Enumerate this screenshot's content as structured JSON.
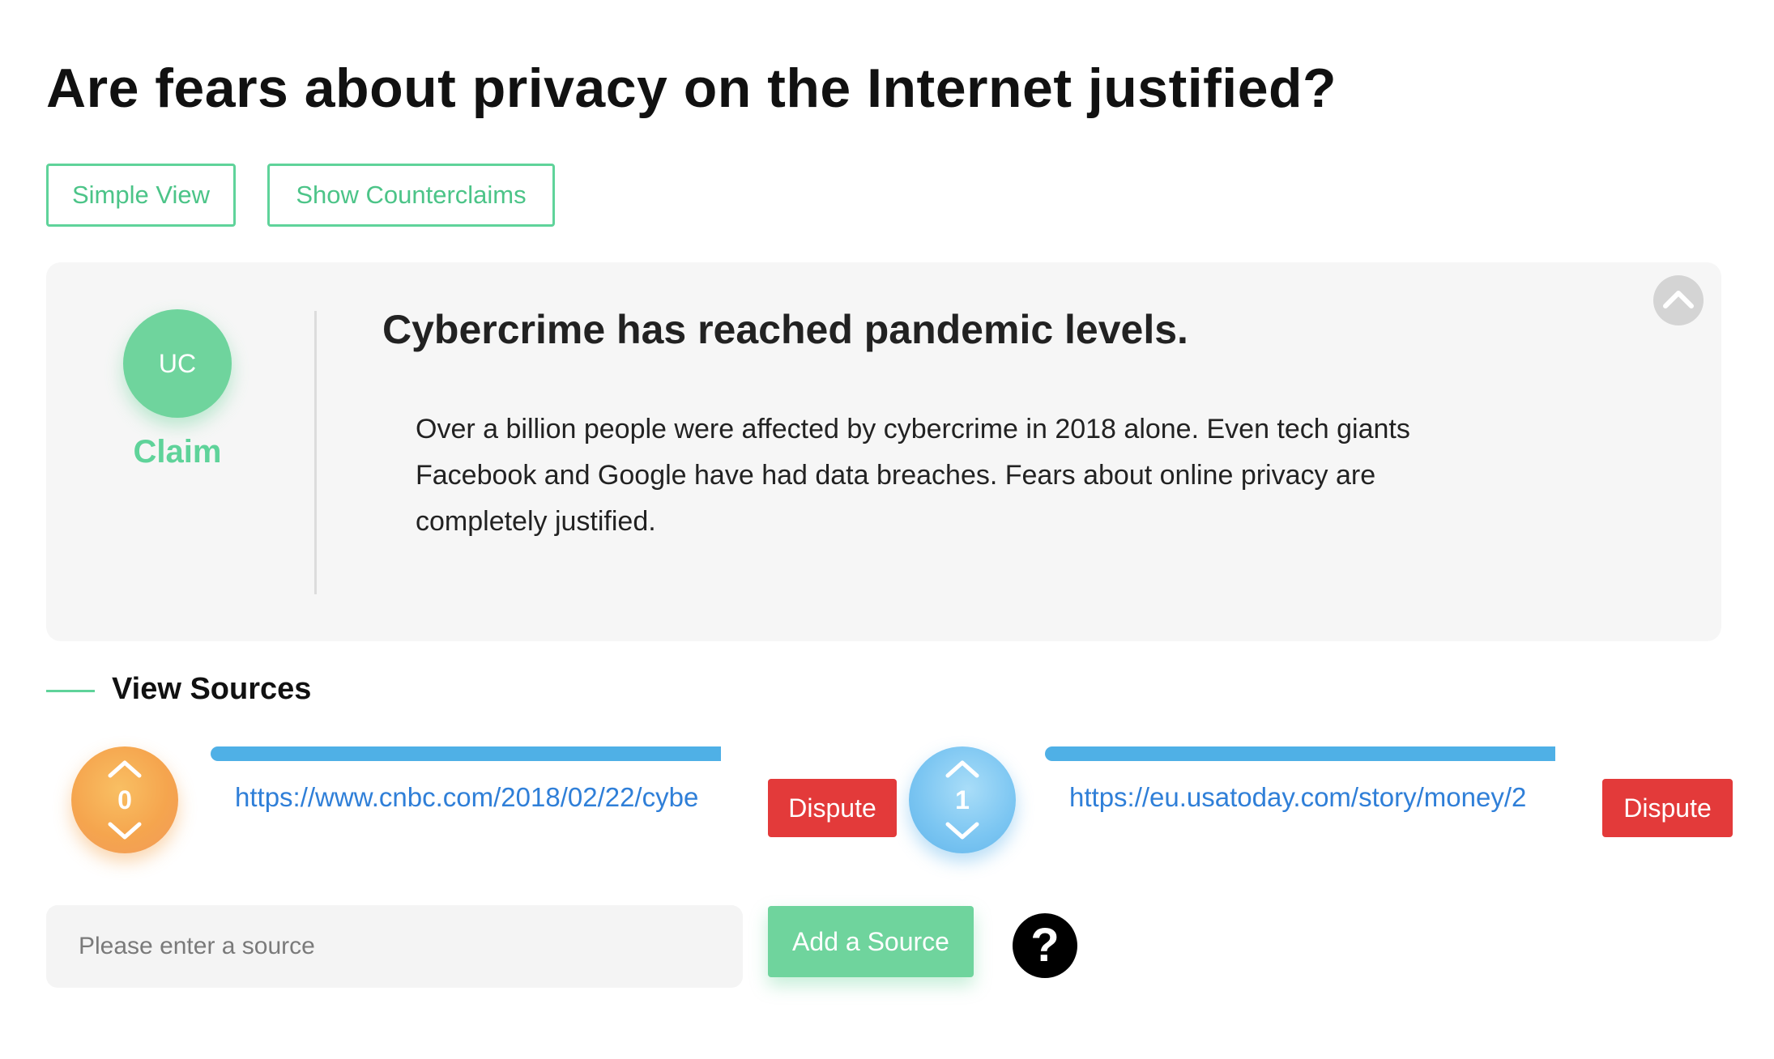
{
  "page": {
    "title": "Are fears about privacy on the Internet justified?"
  },
  "view_buttons": {
    "simple_view": "Simple View",
    "show_counterclaims": "Show Counterclaims"
  },
  "claim": {
    "avatar_initials": "UC",
    "type_label": "Claim",
    "heading": "Cybercrime has reached pandemic levels.",
    "body": "Over a billion people were affected by cybercrime in 2018 alone. Even tech giants Facebook and Google have had data breaches. Fears about online privacy are completely justified.",
    "collapse_icon": "chevron-up-icon"
  },
  "sources": {
    "section_title": "View Sources",
    "items": [
      {
        "votes": "0",
        "url": "https://www.cnbc.com/2018/02/22/cybe",
        "dispute_label": "Dispute",
        "vote_color": "#f5a54e"
      },
      {
        "votes": "1",
        "url": "https://eu.usatoday.com/story/money/2",
        "dispute_label": "Dispute",
        "vote_color": "#7cc6f2"
      }
    ],
    "input_placeholder": "Please enter a source",
    "add_label": "Add a Source",
    "help_label": "?"
  },
  "colors": {
    "accent_green": "#5fd39a",
    "dispute_red": "#e33a3a",
    "link_blue": "#2f7fd8",
    "bar_blue": "#4fb0e6"
  }
}
